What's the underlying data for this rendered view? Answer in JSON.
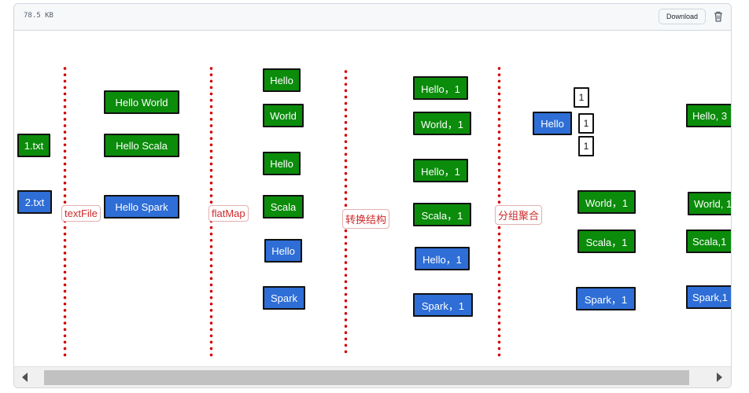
{
  "toolbar": {
    "file_size": "78.5 KB",
    "download_label": "Download",
    "delete_icon": "trash-icon"
  },
  "diagram": {
    "steps": [
      {
        "label": "textFile"
      },
      {
        "label": "flatMap"
      },
      {
        "label": "转换结构"
      },
      {
        "label": "分组聚合"
      }
    ],
    "files": [
      "1.txt",
      "2.txt"
    ],
    "lines": [
      "Hello World",
      "Hello Scala",
      "Hello Spark"
    ],
    "words": [
      "Hello",
      "World",
      "Hello",
      "Scala",
      "Hello",
      "Spark"
    ],
    "pairs": [
      "Hello，1",
      "World，1",
      "Hello，1",
      "Scala，1",
      "Hello，1",
      "Spark，1"
    ],
    "grouped": {
      "key": "Hello",
      "ones": [
        "1",
        "1",
        "1"
      ],
      "others": [
        "World，1",
        "Scala，1",
        "Spark，1"
      ]
    },
    "results": [
      "Hello, 3",
      "World, 1",
      "Scala,1",
      "Spark,1"
    ],
    "colors": {
      "green": "#0b8c0b",
      "blue": "#2e6ed6",
      "separator": "#d10000",
      "label_text": "#cc2a2a"
    }
  },
  "scrollbar": {
    "left_icon": "arrow-left-icon",
    "right_icon": "arrow-right-icon"
  }
}
